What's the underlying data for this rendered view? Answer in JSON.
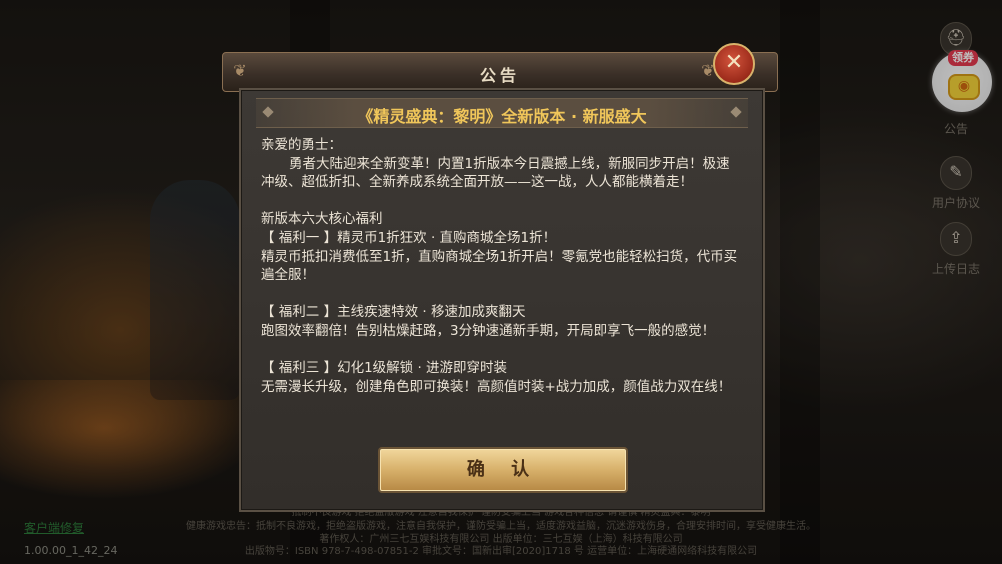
{
  "background": {
    "client_repair": "客户端修复",
    "version": "1.00.00_1_42_24",
    "footer_lines": [
      "抵制不良游戏 拒绝盗版游戏 注意自我保护 谨防受骗上当 游戏各种信息 请谨慎 精灵盛典：黎明",
      "健康游戏忠告：抵制不良游戏，拒绝盗版游戏，注意自我保护，谨防受骗上当，适度游戏益脑，沉迷游戏伤身，合理安排时间，享受健康生活。",
      "著作权人：广州三七互娱科技有限公司 出版单位：三七互娱（上海）科技有限公司",
      "出版物号：ISBN 978-7-498-07851-2 审批文号：国新出审[2020]1718 号 运营单位：上海硬通网络科技有限公司"
    ]
  },
  "side_menu": {
    "coupon_badge": "领券",
    "coupon_icon": "gamepad-icon",
    "items": [
      {
        "label": "公告",
        "icon": "helmet-icon"
      },
      {
        "label": "用户协议",
        "icon": "document-icon"
      },
      {
        "label": "上传日志",
        "icon": "upload-log-icon"
      }
    ]
  },
  "dialog": {
    "title": "公告",
    "close_icon": "close-icon",
    "subtitle": "《精灵盛典：黎明》全新版本 · 新服盛大",
    "content": {
      "greeting": "亲爱的勇士：",
      "intro": "勇者大陆迎来全新变革！内置1折版本今日震撼上线，新服同步开启！极速冲级、超低折扣、全新养成系统全面开放——这一战，人人都能横着走！",
      "section_title": "新版本六大核心福利",
      "benefits": [
        {
          "title": "【 福利一 】精灵币1折狂欢 · 直购商城全场1折！",
          "body": "精灵币抵扣消费低至1折，直购商城全场1折开启！零氪党也能轻松扫货，代币买遍全服！"
        },
        {
          "title": "【 福利二 】主线疾速特效 · 移速加成爽翻天",
          "body": "跑图效率翻倍！告别枯燥赶路，3分钟速通新手期，开局即享飞一般的感觉！"
        },
        {
          "title": "【 福利三 】幻化1级解锁 · 进游即穿时装",
          "body": "无需漫长升级，创建角色即可换装！高颜值时装+战力加成，颜值战力双在线！"
        }
      ]
    },
    "confirm_label": "确 认"
  },
  "colors": {
    "subtitle": "#f0c65a",
    "confirm_button": "#d7b06a",
    "close_button": "#9b2a1a",
    "panel": "#3a3632"
  }
}
